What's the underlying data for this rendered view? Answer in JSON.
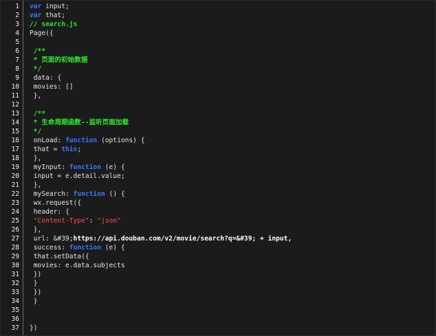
{
  "editor": {
    "lines": [
      {
        "n": "1",
        "tokens": [
          {
            "t": "var",
            "c": "kw"
          },
          {
            "t": " input;",
            "c": "pl"
          }
        ]
      },
      {
        "n": "2",
        "tokens": [
          {
            "t": "var",
            "c": "kw"
          },
          {
            "t": " that;",
            "c": "pl"
          }
        ]
      },
      {
        "n": "3",
        "tokens": [
          {
            "t": "// search.js",
            "c": "cm"
          }
        ]
      },
      {
        "n": "4",
        "tokens": [
          {
            "t": "Page({",
            "c": "pl"
          }
        ]
      },
      {
        "n": "5",
        "tokens": []
      },
      {
        "n": "6",
        "tokens": [
          {
            "t": " /**",
            "c": "cm"
          }
        ]
      },
      {
        "n": "7",
        "tokens": [
          {
            "t": " * 页面的初始数据",
            "c": "cm"
          }
        ]
      },
      {
        "n": "8",
        "tokens": [
          {
            "t": " */",
            "c": "cm"
          }
        ]
      },
      {
        "n": "9",
        "tokens": [
          {
            "t": " data: {",
            "c": "pl"
          }
        ]
      },
      {
        "n": "10",
        "tokens": [
          {
            "t": " movies: []",
            "c": "pl"
          }
        ]
      },
      {
        "n": "11",
        "tokens": [
          {
            "t": " },",
            "c": "pl"
          }
        ]
      },
      {
        "n": "12",
        "tokens": []
      },
      {
        "n": "13",
        "tokens": [
          {
            "t": " /**",
            "c": "cm"
          }
        ]
      },
      {
        "n": "14",
        "tokens": [
          {
            "t": " * 生命周期函数--监听页面加载",
            "c": "cm"
          }
        ]
      },
      {
        "n": "15",
        "tokens": [
          {
            "t": " */",
            "c": "cm"
          }
        ]
      },
      {
        "n": "16",
        "tokens": [
          {
            "t": " onLoad: ",
            "c": "pl"
          },
          {
            "t": "function",
            "c": "kw"
          },
          {
            "t": " (options) {",
            "c": "pl"
          }
        ]
      },
      {
        "n": "17",
        "tokens": [
          {
            "t": " that = ",
            "c": "pl"
          },
          {
            "t": "this",
            "c": "kw"
          },
          {
            "t": ";",
            "c": "pl"
          }
        ]
      },
      {
        "n": "18",
        "tokens": [
          {
            "t": " },",
            "c": "pl"
          }
        ]
      },
      {
        "n": "19",
        "tokens": [
          {
            "t": " myInput: ",
            "c": "pl"
          },
          {
            "t": "function",
            "c": "kw"
          },
          {
            "t": " (e) {",
            "c": "pl"
          }
        ]
      },
      {
        "n": "20",
        "tokens": [
          {
            "t": " input = e.detail.value;",
            "c": "pl"
          }
        ]
      },
      {
        "n": "21",
        "tokens": [
          {
            "t": " },",
            "c": "pl"
          }
        ]
      },
      {
        "n": "22",
        "tokens": [
          {
            "t": " mySearch: ",
            "c": "pl"
          },
          {
            "t": "function",
            "c": "kw"
          },
          {
            "t": " () {",
            "c": "pl"
          }
        ]
      },
      {
        "n": "23",
        "tokens": [
          {
            "t": " wx.request({",
            "c": "pl"
          }
        ]
      },
      {
        "n": "24",
        "tokens": [
          {
            "t": " header: {",
            "c": "pl"
          }
        ]
      },
      {
        "n": "25",
        "tokens": [
          {
            "t": " \"Content-Type\"",
            "c": "str"
          },
          {
            "t": ": ",
            "c": "pl"
          },
          {
            "t": "\"json\"",
            "c": "str"
          }
        ]
      },
      {
        "n": "26",
        "tokens": [
          {
            "t": " },",
            "c": "pl"
          }
        ]
      },
      {
        "n": "27",
        "tokens": [
          {
            "t": " url: &#39;",
            "c": "pl"
          },
          {
            "t": "https://api.douban.com/v2/movie/search?q=&#39; + input,",
            "c": "url"
          }
        ]
      },
      {
        "n": "28",
        "tokens": [
          {
            "t": " success: ",
            "c": "pl"
          },
          {
            "t": "function",
            "c": "kw"
          },
          {
            "t": " (e) {",
            "c": "pl"
          }
        ]
      },
      {
        "n": "29",
        "tokens": [
          {
            "t": " that.setData({",
            "c": "pl"
          }
        ]
      },
      {
        "n": "30",
        "tokens": [
          {
            "t": " movies: e.data.subjects",
            "c": "pl"
          }
        ]
      },
      {
        "n": "31",
        "tokens": [
          {
            "t": " })",
            "c": "pl"
          }
        ]
      },
      {
        "n": "32",
        "tokens": [
          {
            "t": " }",
            "c": "pl"
          }
        ]
      },
      {
        "n": "33",
        "tokens": [
          {
            "t": " })",
            "c": "pl"
          }
        ]
      },
      {
        "n": "34",
        "tokens": [
          {
            "t": " }",
            "c": "pl"
          }
        ]
      },
      {
        "n": "35",
        "tokens": []
      },
      {
        "n": "36",
        "tokens": []
      },
      {
        "n": "37",
        "tokens": [
          {
            "t": "})",
            "c": "pl"
          }
        ]
      }
    ]
  }
}
